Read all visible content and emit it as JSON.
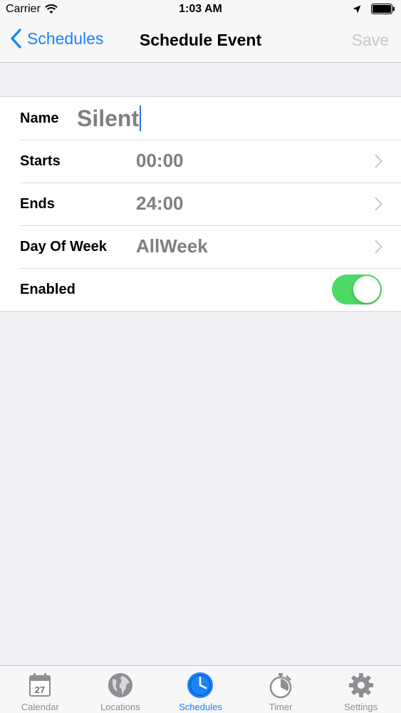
{
  "status_bar": {
    "carrier": "Carrier",
    "time": "1:03 AM"
  },
  "nav": {
    "back_label": "Schedules",
    "title": "Schedule Event",
    "save_label": "Save"
  },
  "form": {
    "name_label": "Name",
    "name_value": "Silent",
    "starts_label": "Starts",
    "starts_value": "00:00",
    "ends_label": "Ends",
    "ends_value": "24:00",
    "day_label": "Day Of Week",
    "day_value": "AllWeek",
    "enabled_label": "Enabled",
    "enabled": true
  },
  "tabs": [
    {
      "label": "Calendar",
      "icon": "calendar-icon",
      "badge": "27"
    },
    {
      "label": "Locations",
      "icon": "globe-icon"
    },
    {
      "label": "Schedules",
      "icon": "clock-icon",
      "active": true
    },
    {
      "label": "Timer",
      "icon": "stopwatch-icon"
    },
    {
      "label": "Settings",
      "icon": "gear-icon"
    }
  ],
  "colors": {
    "accent": "#1a82fb",
    "toggle_on": "#4cd964",
    "disabled": "#c7c7cc"
  }
}
